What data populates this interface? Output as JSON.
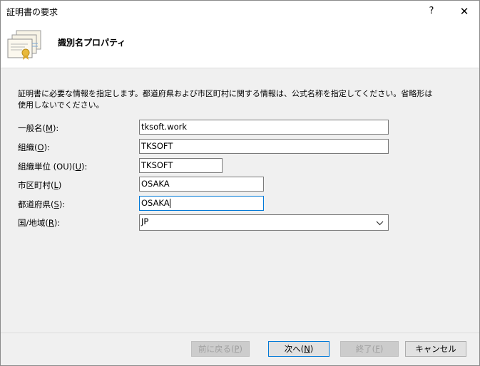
{
  "window": {
    "title": "証明書の要求",
    "help_glyph": "?",
    "close_glyph": "✕"
  },
  "header": {
    "title": "識別名プロパティ"
  },
  "description": "証明書に必要な情報を指定します。都道府県および市区町村に関する情報は、公式名称を指定してください。省略形は使用しないでください。",
  "fields": {
    "common_name": {
      "label_pre": "一般名(",
      "key": "M",
      "label_post": "):",
      "value": "tksoft.work"
    },
    "organization": {
      "label_pre": "組織(",
      "key": "O",
      "label_post": "):",
      "value": "TKSOFT"
    },
    "org_unit": {
      "label_pre": "組織単位 (OU)(",
      "key": "U",
      "label_post": "):",
      "value": "TKSOFT"
    },
    "city": {
      "label_pre": "市区町村(",
      "key": "L",
      "label_post": ")",
      "value": "OSAKA"
    },
    "state": {
      "label_pre": "都道府県(",
      "key": "S",
      "label_post": "):",
      "value": "OSAKA"
    },
    "country": {
      "label_pre": "国/地域(",
      "key": "R",
      "label_post": "):",
      "value": "JP"
    }
  },
  "buttons": {
    "back": {
      "pre": "前に戻る(",
      "key": "P",
      "post": ")"
    },
    "next": {
      "pre": "次へ(",
      "key": "N",
      "post": ")"
    },
    "finish": {
      "pre": "終了(",
      "key": "F",
      "post": ")"
    },
    "cancel": {
      "label": "キャンセル"
    }
  },
  "icons": {
    "header": "certificate-stack-icon",
    "dropdown": "chevron-down-icon"
  },
  "colors": {
    "focus_border": "#0078d7",
    "disabled_text": "#a0a0a0"
  }
}
